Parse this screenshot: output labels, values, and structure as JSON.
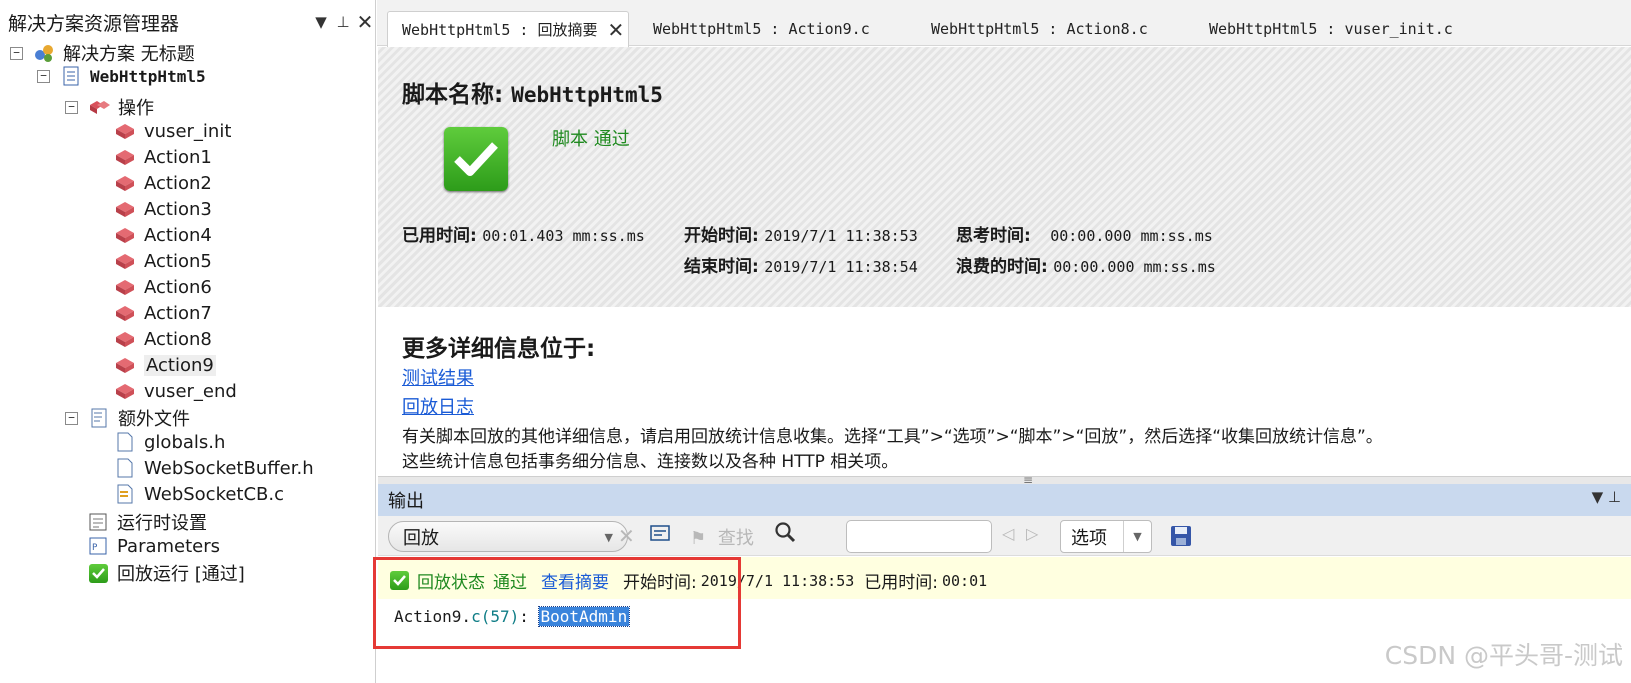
{
  "explorer": {
    "title": "解决方案资源管理器",
    "solution": "解决方案 无标题",
    "project": "WebHttpHtml5",
    "actions_folder": "操作",
    "actions": [
      "vuser_init",
      "Action1",
      "Action2",
      "Action3",
      "Action4",
      "Action5",
      "Action6",
      "Action7",
      "Action8",
      "Action9",
      "vuser_end"
    ],
    "selected_action": "Action9",
    "extra_folder": "额外文件",
    "extra_files": [
      "globals.h",
      "WebSocketBuffer.h",
      "WebSocketCB.c"
    ],
    "runtime_settings": "运行时设置",
    "parameters": "Parameters",
    "replay_run": "回放运行 [通过]"
  },
  "tabs": [
    {
      "label": "WebHttpHtml5 : 回放摘要",
      "active": true
    },
    {
      "label": "WebHttpHtml5 : Action9.c",
      "active": false
    },
    {
      "label": "WebHttpHtml5 : Action8.c",
      "active": false
    },
    {
      "label": "WebHttpHtml5 : vuser_init.c",
      "active": false
    }
  ],
  "summary": {
    "script_label": "脚本名称:",
    "script_name": "WebHttpHtml5",
    "status": "脚本 通过",
    "elapsed_label": "已用时间:",
    "elapsed_value": "00:01.403 mm:ss.ms",
    "start_label": "开始时间:",
    "start_value": "2019/7/1 11:38:53",
    "end_label": "结束时间:",
    "end_value": "2019/7/1 11:38:54",
    "think_label": "思考时间:",
    "think_value": "00:00.000 mm:ss.ms",
    "wasted_label": "浪费的时间:",
    "wasted_value": "00:00.000 mm:ss.ms"
  },
  "details": {
    "title": "更多详细信息位于:",
    "link_results": "测试结果",
    "link_log": "回放日志",
    "line1": "有关脚本回放的其他详细信息，请启用回放统计信息收集。选择“工具”>“选项”>“脚本”>“回放”，然后选择“收集回放统计信息”。",
    "line2": "这些统计信息包括事务细分信息、连接数以及各种 HTTP 相关项。"
  },
  "output": {
    "title": "输出",
    "mode": "回放",
    "find_label": "查找",
    "options_label": "选项",
    "search_value": "",
    "status_label": "回放状态",
    "status_value": "通过",
    "view_summary": "查看摘要",
    "start_label": "开始时间:",
    "start_value": "2019/7/1 11:38:53",
    "elapsed_label": "已用时间:",
    "elapsed_value": "00:01",
    "log_file": "Action9.",
    "log_ext": "c",
    "log_line_no": "(57)",
    "log_sep": ": ",
    "log_message": "BootAdmin"
  },
  "watermark": "CSDN @平头哥-测试",
  "colors": {
    "link": "#1a5bd6",
    "pass_green": "#208a20",
    "output_header": "#c9d9ee",
    "highlight": "#3a84dc",
    "annotation_red": "#e53935"
  }
}
